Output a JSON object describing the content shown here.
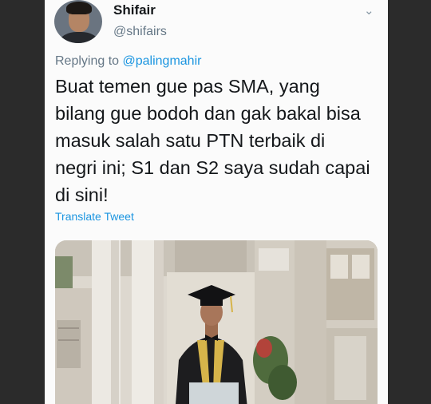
{
  "tweet": {
    "author": {
      "display_name": "Shifair",
      "handle": "@shifairs",
      "avatar_icon": "profile-photo"
    },
    "menu_icon": "chevron-down-icon",
    "reply_context": {
      "prefix": "Replying to",
      "mention": "@palingmahir"
    },
    "text_lines": [
      "Buat temen gue pas SMA, yang",
      "bilang gue bodoh dan gak bakal bisa",
      "masuk salah satu PTN terbaik di",
      "negri ini; S1 dan S2 saya sudah capai",
      "di sini!"
    ],
    "translate_label": "Translate Tweet",
    "media": {
      "type": "photo",
      "subject": "graduation-photo"
    }
  },
  "colors": {
    "background": "#2b2b2b",
    "card": "#fbfbfb",
    "text": "#14171a",
    "muted": "#657786",
    "link": "#1b95e0"
  }
}
